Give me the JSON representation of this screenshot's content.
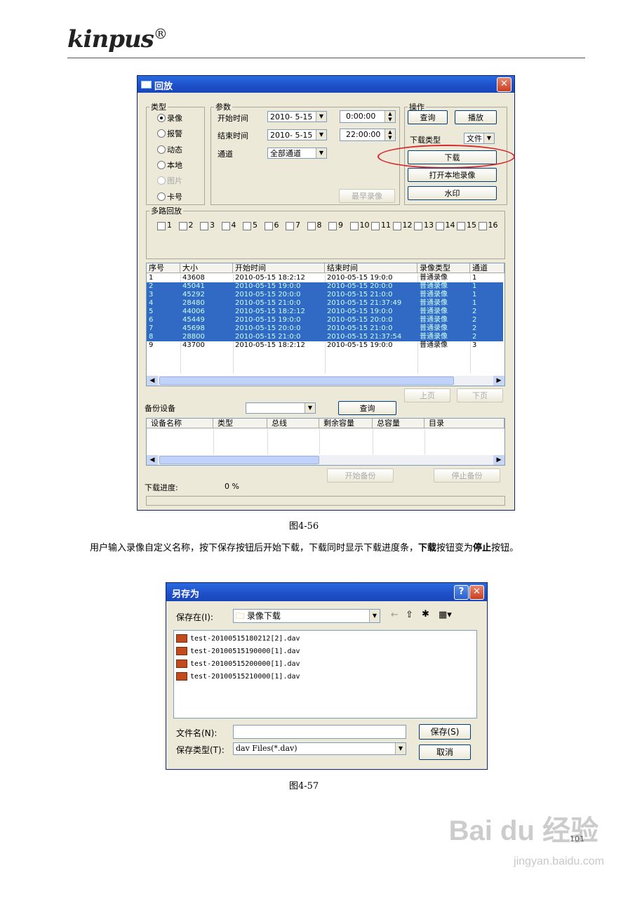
{
  "header": {
    "brand": "kinpus",
    "registered": "®"
  },
  "playback_window": {
    "title": "回放",
    "type_group": {
      "legend": "类型",
      "options": [
        {
          "label": "录像",
          "selected": true,
          "disabled": false
        },
        {
          "label": "报警",
          "selected": false,
          "disabled": false
        },
        {
          "label": "动态",
          "selected": false,
          "disabled": false
        },
        {
          "label": "本地",
          "selected": false,
          "disabled": false
        },
        {
          "label": "图片",
          "selected": false,
          "disabled": true
        },
        {
          "label": "卡号",
          "selected": false,
          "disabled": false
        }
      ]
    },
    "params": {
      "legend": "参数",
      "start_label": "开始时间",
      "start_date": "2010- 5-15",
      "start_time": "0:00:00",
      "end_label": "结束时间",
      "end_date": "2010- 5-15",
      "end_time": "22:00:00",
      "channel_label": "通道",
      "channel_value": "全部通道",
      "earliest_button": "最早录像"
    },
    "ops": {
      "legend": "操作",
      "query": "查询",
      "play": "播放",
      "download_type_label": "下载类型",
      "download_type_value": "文件",
      "download": "下载",
      "open_local": "打开本地录像",
      "watermark": "水印"
    },
    "multi": {
      "legend": "多路回放",
      "channels": [
        "1",
        "2",
        "3",
        "4",
        "5",
        "6",
        "7",
        "8",
        "9",
        "10",
        "11",
        "12",
        "13",
        "14",
        "15",
        "16"
      ]
    },
    "list": {
      "columns": [
        "序号",
        "大小",
        "开始时间",
        "结束时间",
        "录像类型",
        "通道"
      ],
      "rows": [
        {
          "no": "1",
          "size": "43608",
          "start": "2010-05-15 18:2:12",
          "end": "2010-05-15 19:0:0",
          "type": "普通录像",
          "ch": "1",
          "sel": false
        },
        {
          "no": "2",
          "size": "45041",
          "start": "2010-05-15 19:0:0",
          "end": "2010-05-15 20:0:0",
          "type": "普通录像",
          "ch": "1",
          "sel": true
        },
        {
          "no": "3",
          "size": "45292",
          "start": "2010-05-15 20:0:0",
          "end": "2010-05-15 21:0:0",
          "type": "普通录像",
          "ch": "1",
          "sel": true
        },
        {
          "no": "4",
          "size": "28480",
          "start": "2010-05-15 21:0:0",
          "end": "2010-05-15 21:37:49",
          "type": "普通录像",
          "ch": "1",
          "sel": true
        },
        {
          "no": "5",
          "size": "44006",
          "start": "2010-05-15 18:2:12",
          "end": "2010-05-15 19:0:0",
          "type": "普通录像",
          "ch": "2",
          "sel": true
        },
        {
          "no": "6",
          "size": "45449",
          "start": "2010-05-15 19:0:0",
          "end": "2010-05-15 20:0:0",
          "type": "普通录像",
          "ch": "2",
          "sel": true
        },
        {
          "no": "7",
          "size": "45698",
          "start": "2010-05-15 20:0:0",
          "end": "2010-05-15 21:0:0",
          "type": "普通录像",
          "ch": "2",
          "sel": true
        },
        {
          "no": "8",
          "size": "28800",
          "start": "2010-05-15 21:0:0",
          "end": "2010-05-15 21:37:54",
          "type": "普通录像",
          "ch": "2",
          "sel": true
        },
        {
          "no": "9",
          "size": "43700",
          "start": "2010-05-15 18:2:12",
          "end": "2010-05-15 19:0:0",
          "type": "普通录像",
          "ch": "3",
          "sel": false
        }
      ],
      "prev": "上页",
      "next": "下页"
    },
    "backup": {
      "label": "备份设备",
      "device_value": "",
      "query": "查询",
      "columns": [
        "设备名称",
        "类型",
        "总线",
        "剩余容量",
        "总容量",
        "目录"
      ],
      "start": "开始备份",
      "stop": "停止备份"
    },
    "progress": {
      "label": "下载进度:",
      "value": "0 %"
    }
  },
  "caption1": "图4-56",
  "paragraph": {
    "p1": "用户输入录像自定义名称，按下保存按钮后开始下载，下载同时显示下载进度条，",
    "b1": "下载",
    "p2": "按钮变为",
    "b2": "停止",
    "p3": "按钮。"
  },
  "save_dialog": {
    "title": "另存为",
    "save_in_label": "保存在(I):",
    "folder": "录像下载",
    "files": [
      "test-20100515180212[2].dav",
      "test-20100515190000[1].dav",
      "test-20100515200000[1].dav",
      "test-20100515210000[1].dav"
    ],
    "filename_label": "文件名(N):",
    "filename_value": "",
    "filetype_label": "保存类型(T):",
    "filetype_value": "dav Files(*.dav)",
    "save": "保存(S)",
    "cancel": "取消"
  },
  "caption2": "图4-57",
  "page_number": "101",
  "watermark": {
    "main": "Bai du 经验",
    "sub": "jingyan.baidu.com"
  }
}
